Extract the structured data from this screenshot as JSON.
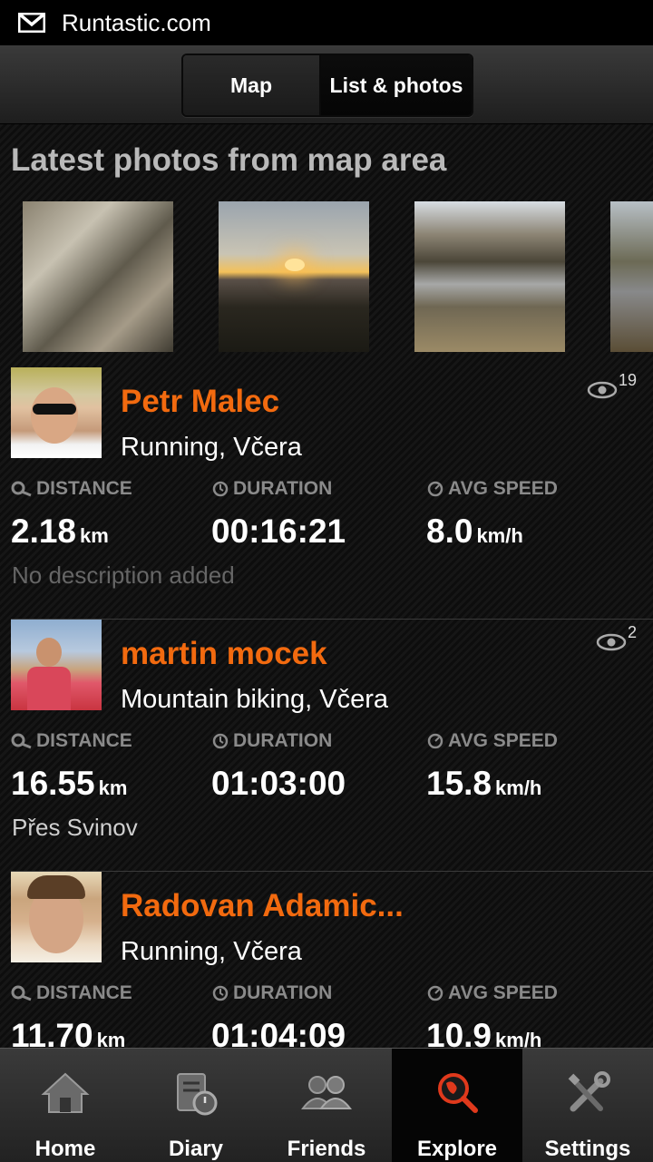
{
  "status_bar": {
    "title": "Runtastic.com",
    "icon": "gmail-icon"
  },
  "tabs": {
    "map_label": "Map",
    "list_label": "List & photos",
    "active": "List & photos"
  },
  "photos_section": {
    "title": "Latest photos from map area",
    "photos": [
      "photo-1",
      "photo-2",
      "photo-3",
      "photo-4"
    ]
  },
  "feed": [
    {
      "name": "Petr Malec",
      "activity": "Running, Včera",
      "views": "19",
      "stats": [
        {
          "label": "DISTANCE",
          "value": "2.18",
          "unit": "km",
          "icon": "distance-icon"
        },
        {
          "label": "DURATION",
          "value": "00:16:21",
          "unit": "",
          "icon": "clock-icon"
        },
        {
          "label": "AVG SPEED",
          "value": "8.0",
          "unit": "km/h",
          "icon": "speed-icon"
        }
      ],
      "description": "No description added"
    },
    {
      "name": "martin mocek",
      "activity": "Mountain biking, Včera",
      "views": "2",
      "stats": [
        {
          "label": "DISTANCE",
          "value": "16.55",
          "unit": "km",
          "icon": "distance-icon"
        },
        {
          "label": "DURATION",
          "value": "01:03:00",
          "unit": "",
          "icon": "clock-icon"
        },
        {
          "label": "AVG SPEED",
          "value": "15.8",
          "unit": "km/h",
          "icon": "speed-icon"
        }
      ],
      "description": "Přes Svinov"
    },
    {
      "name": "Radovan Adamic...",
      "activity": "Running, Včera",
      "views": "",
      "stats": [
        {
          "label": "DISTANCE",
          "value": "11.70",
          "unit": "km",
          "icon": "distance-icon"
        },
        {
          "label": "DURATION",
          "value": "01:04:09",
          "unit": "",
          "icon": "clock-icon"
        },
        {
          "label": "AVG SPEED",
          "value": "10.9",
          "unit": "km/h",
          "icon": "speed-icon"
        }
      ],
      "description": ""
    }
  ],
  "bottom_nav": [
    {
      "label": "Home",
      "icon": "home-icon"
    },
    {
      "label": "Diary",
      "icon": "diary-icon"
    },
    {
      "label": "Friends",
      "icon": "friends-icon"
    },
    {
      "label": "Explore",
      "icon": "explore-icon",
      "active": true
    },
    {
      "label": "Settings",
      "icon": "settings-icon"
    }
  ],
  "colors": {
    "accent": "#f26a0f",
    "label_gray": "#8a8a8a",
    "background": "#111111"
  }
}
